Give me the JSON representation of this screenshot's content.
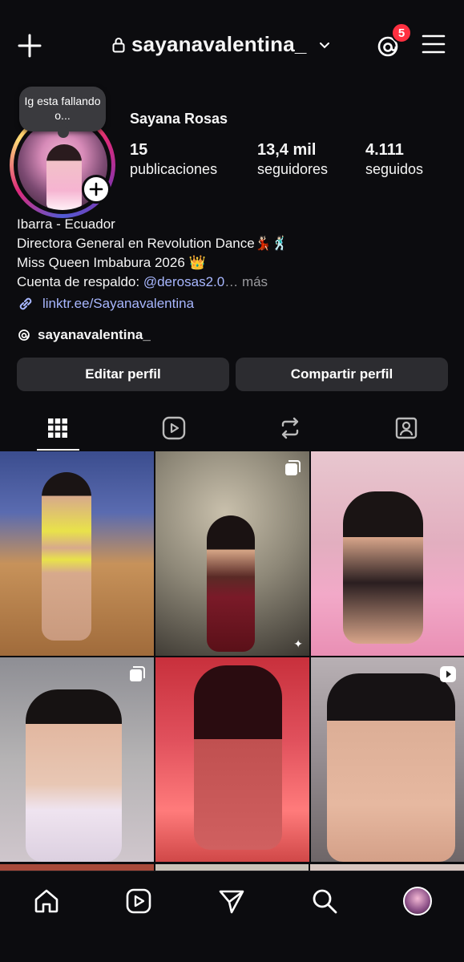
{
  "header": {
    "username": "sayanavalentina_",
    "notification_count": "5"
  },
  "profile": {
    "note": "Ig esta fallando o...",
    "display_name": "Sayana Rosas",
    "stats": [
      {
        "value": "15",
        "label": "publicaciones"
      },
      {
        "value": "13,4 mil",
        "label": "seguidores"
      },
      {
        "value": "4.111",
        "label": "seguidos"
      }
    ],
    "bio_lines": [
      "Ibarra - Ecuador",
      "Directora General en Revolution Dance💃🏻🕺🏻",
      "Miss Queen Imbabura 2026 👑"
    ],
    "backup_prefix": "Cuenta de respaldo: ",
    "backup_mention": "@derosas2.0",
    "more": "… más",
    "link": "linktr.ee/Sayanavalentina",
    "threads_handle": "sayanavalentina_"
  },
  "actions": {
    "edit": "Editar perfil",
    "share": "Compartir perfil"
  },
  "tabs": [
    "grid-icon",
    "reels-icon",
    "reposts-icon",
    "tagged-icon"
  ],
  "colors": {
    "background": "#0c0c0f",
    "button": "#2c2c30",
    "link": "#a8b7ff",
    "badge": "#ff3040"
  },
  "posts": [
    {
      "kind": "photo",
      "badge": "none"
    },
    {
      "kind": "carousel",
      "badge": "carousel-icon"
    },
    {
      "kind": "photo",
      "badge": "none"
    },
    {
      "kind": "carousel",
      "badge": "carousel-icon"
    },
    {
      "kind": "photo",
      "badge": "none"
    },
    {
      "kind": "reel",
      "badge": "reel-icon"
    }
  ],
  "bottom_nav": [
    "home-icon",
    "reels-icon",
    "send-icon",
    "search-icon",
    "profile-avatar"
  ]
}
